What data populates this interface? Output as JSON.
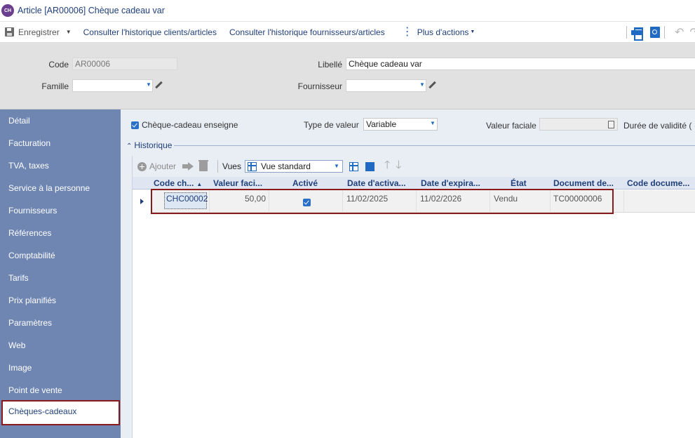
{
  "window": {
    "title": "Article [AR00006] Chèque cadeau var",
    "logo_text": "CH"
  },
  "toolbar": {
    "save_label": "Enregistrer",
    "link_history_clients": "Consulter l'historique clients/articles",
    "link_history_suppliers": "Consulter l'historique fournisseurs/articles",
    "more_actions": "Plus d'actions"
  },
  "header_form": {
    "code_label": "Code",
    "code_value": "AR00006",
    "libelle_label": "Libellé",
    "libelle_value": "Chèque cadeau var",
    "famille_label": "Famille",
    "famille_value": "",
    "fournisseur_label": "Fournisseur",
    "fournisseur_value": ""
  },
  "sidebar": {
    "items": [
      {
        "label": "Détail"
      },
      {
        "label": "Facturation"
      },
      {
        "label": "TVA, taxes"
      },
      {
        "label": "Service à la personne"
      },
      {
        "label": "Fournisseurs"
      },
      {
        "label": "Références"
      },
      {
        "label": "Comptabilité"
      },
      {
        "label": "Tarifs"
      },
      {
        "label": "Prix planifiés"
      },
      {
        "label": "Paramètres"
      },
      {
        "label": "Web"
      },
      {
        "label": "Image"
      },
      {
        "label": "Point de vente"
      },
      {
        "label": "Chèques-cadeaux",
        "active": true
      }
    ]
  },
  "main": {
    "enseigne_label": "Chèque-cadeau enseigne",
    "enseigne_checked": true,
    "type_valeur_label": "Type de valeur",
    "type_valeur_value": "Variable",
    "valeur_faciale_label": "Valeur faciale",
    "valeur_faciale_value": "",
    "duree_label": "Durée de validité (",
    "section_title": "Historique"
  },
  "grid_toolbar": {
    "add_label": "Ajouter",
    "vues_label": "Vues",
    "vues_value": "Vue standard"
  },
  "grid": {
    "columns": [
      "Code ch...",
      "Valeur faci...",
      "Activé",
      "Date d'activa...",
      "Date d'expira...",
      "État",
      "Document de...",
      "Code docume..."
    ],
    "rows": [
      {
        "code": "CHC00002",
        "valeur": "50,00",
        "active": true,
        "date_activation": "11/02/2025",
        "date_expiration": "11/02/2026",
        "etat": "Vendu",
        "document": "TC00000006",
        "code_document": ""
      }
    ]
  },
  "colors": {
    "sidebar_bg": "#6f86b3",
    "accent_blue": "#1f6bc4",
    "title_blue": "#1f3f7a",
    "highlight_red": "#8b1a1a"
  }
}
